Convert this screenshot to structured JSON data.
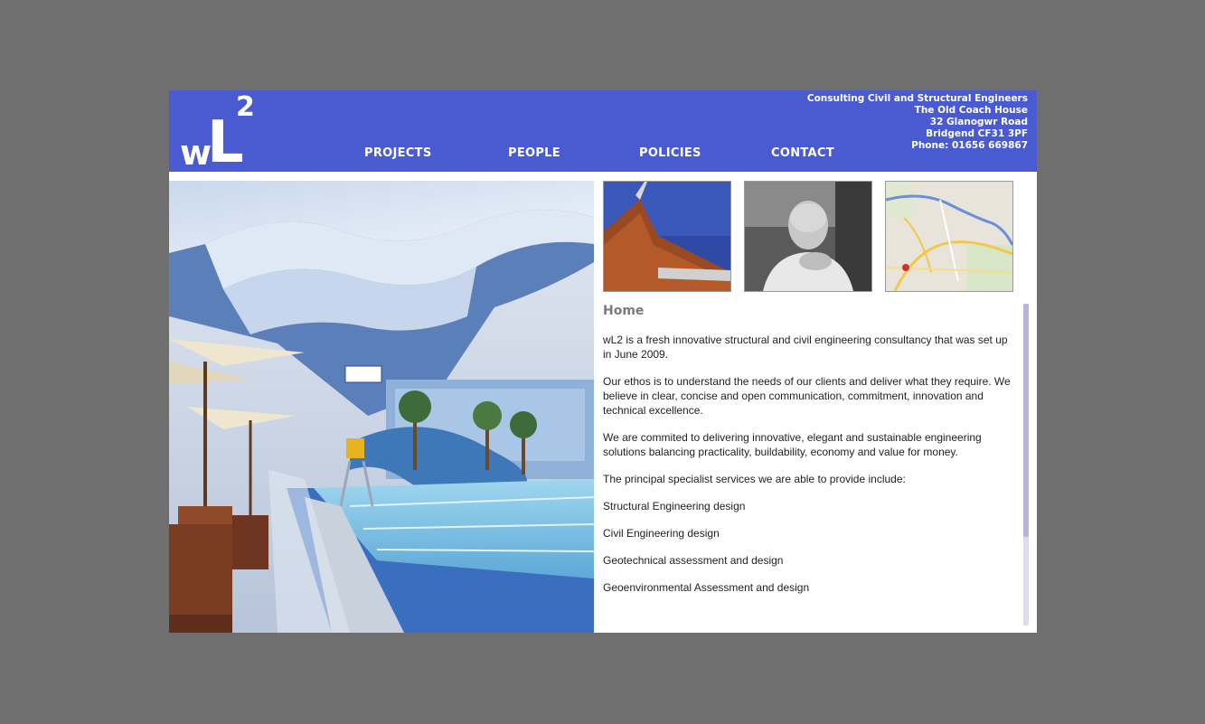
{
  "brand": {
    "logo_text_w": "w",
    "logo_text_L": "L",
    "logo_text_sup": "2",
    "color": "#4a5bd1"
  },
  "nav": {
    "items": [
      "PROJECTS",
      "PEOPLE",
      "POLICIES",
      "CONTACT"
    ]
  },
  "address": {
    "line1": "Consulting Civil and Structural Engineers",
    "line2": "The Old Coach House",
    "line3": "32 Glanogwr Road",
    "line4": "Bridgend CF31 3PF",
    "line5": "Phone: 01656 669867"
  },
  "images": {
    "hero": "indoor-pool-photo",
    "thumb1": "building-roof-photo",
    "thumb2": "person-portrait-photo",
    "thumb3": "location-map"
  },
  "content": {
    "heading": "Home",
    "paragraphs": [
      "wL2 is a fresh innovative structural and civil engineering consultancy that was set up in June 2009.",
      "Our ethos is to understand the needs of our clients and deliver what they require. We believe in clear, concise and open communication, commitment, innovation and technical excellence.",
      "We are commited to delivering innovative, elegant and sustainable engineering solutions balancing practicality, buildability, economy and value for money.",
      "The principal specialist services we are able to provide include:"
    ],
    "services": [
      "Structural Engineering design",
      "Civil Engineering design",
      "Geotechnical assessment and design",
      "Geoenvironmental Assessment and design"
    ]
  }
}
